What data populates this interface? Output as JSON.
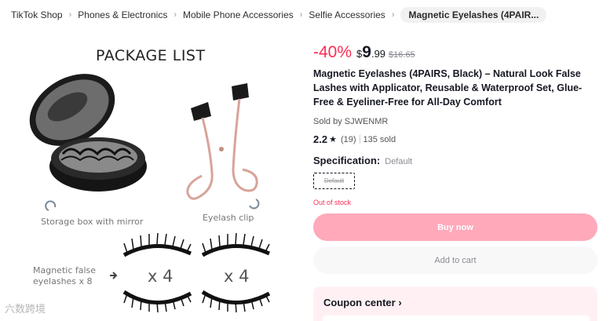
{
  "breadcrumb": {
    "items": [
      "TikTok Shop",
      "Phones & Electronics",
      "Mobile Phone Accessories",
      "Selfie Accessories"
    ],
    "current": "Magnetic Eyelashes (4PAIR..."
  },
  "image": {
    "heading": "PACKAGE LIST",
    "storage_label": "Storage box with mirror",
    "clip_label": "Eyelash clip",
    "false_label": "Magnetic false eyelashes x 8",
    "x4_left": "x 4",
    "x4_right": "x 4",
    "watermark": "六数跨境"
  },
  "product": {
    "discount": "-40%",
    "currency": "$",
    "price_int": "9",
    "price_dec": ".99",
    "original_price": "$16.65",
    "title": "Magnetic Eyelashes (4PAIRS, Black) – Natural Look False Lashes with Applicator, Reusable & Waterproof Set, Glue-Free & Eyeliner-Free for All-Day Comfort",
    "sold_by": "Sold by SJWENMR",
    "rating": "2.2",
    "rating_count": "(19)",
    "sold": "135 sold",
    "spec_label": "Specification:",
    "spec_value": "Default",
    "spec_option": "Default",
    "stock_status": "Out of stock"
  },
  "actions": {
    "buy_now": "Buy now",
    "add_to_cart": "Add to cart"
  },
  "coupon": {
    "label": "Coupon center"
  },
  "colors": {
    "accent": "#fe2c55",
    "buy_button": "#ffa9bb",
    "coupon_bg": "#fff1f3"
  },
  "icons": [
    "chevron-right-icon",
    "star-icon",
    "rotate-arrow-icon"
  ]
}
